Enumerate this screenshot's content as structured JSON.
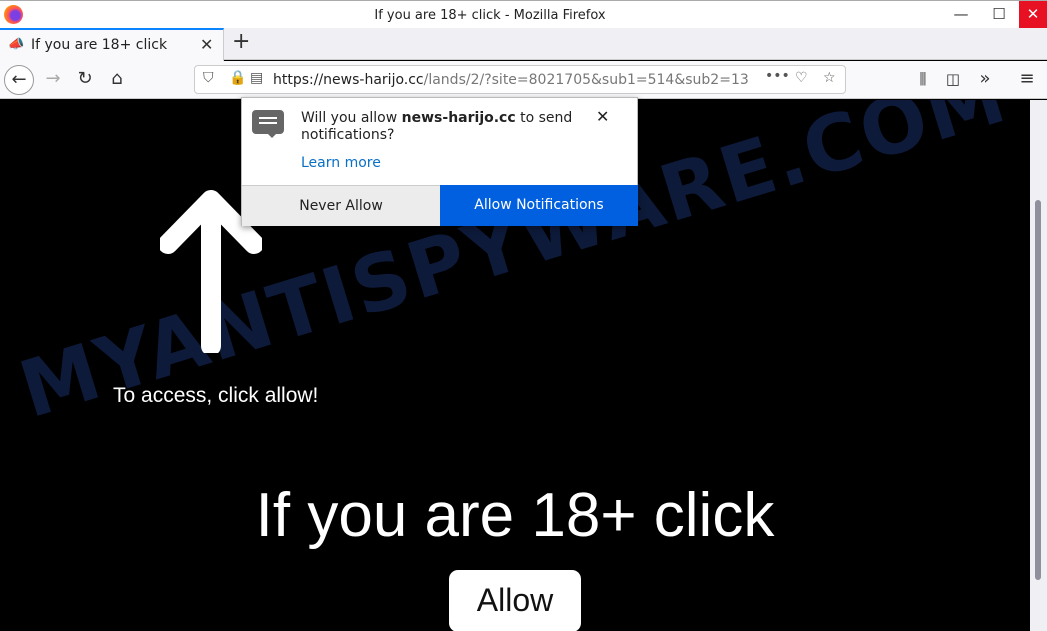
{
  "window": {
    "title": "If you are 18+ click - Mozilla Firefox",
    "minimize": "—",
    "maximize": "☐",
    "close": "✕"
  },
  "tab": {
    "label": "If you are 18+ click",
    "close": "✕",
    "new_tab": "+"
  },
  "nav": {
    "url_host": "https://news-harijo.cc",
    "url_rest": "/lands/2/?site=8021705&sub1=514&sub2=13"
  },
  "popup": {
    "text_pre": "Will you allow ",
    "site": "news-harijo.cc",
    "text_post": " to send notifications?",
    "learn_more": "Learn more",
    "never_allow": "Never Allow",
    "allow_notifications": "Allow Notifications",
    "close": "✕"
  },
  "page": {
    "access_text": "To access, click allow!",
    "headline": "If you are 18+ click",
    "allow_button": "Allow",
    "watermark": "MYANTISPYWARE.COM"
  },
  "colors": {
    "accent": "#0060df",
    "close_red": "#e81123"
  }
}
